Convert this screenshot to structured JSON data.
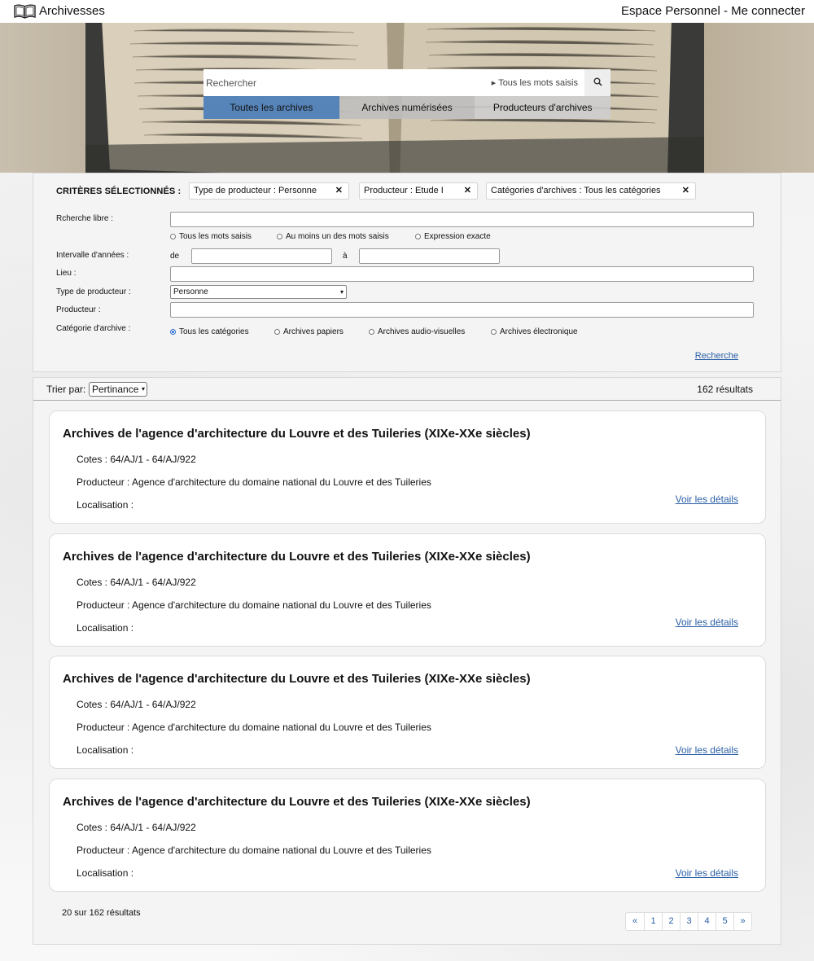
{
  "header": {
    "logo_text": "Archivesses",
    "account_link": "Espace Personnel - Me connecter"
  },
  "search": {
    "placeholder": "Rechercher",
    "mode": "Tous les mots saisis",
    "tabs": [
      "Toutes les archives",
      "Archives numérisées",
      "Producteurs d'archives"
    ]
  },
  "criteria": {
    "title": "CRITÈRES SÉLECTIONNÉS :",
    "chips": [
      "Type de producteur : Personne",
      "Producteur : Etude I",
      "Catégories d'archives : Tous les catégories"
    ],
    "chip_close": "✕",
    "free_search_label": "Rcherche libre :",
    "free_search_options": [
      "Tous les mots saisis",
      "Au moins un des mots saisis",
      "Expression exacte"
    ],
    "years_label": "Intervalle d'années :",
    "years_from": "de",
    "years_to": "à",
    "place_label": "Lieu :",
    "producer_type_label": "Type de producteur :",
    "producer_type_value": "Personne",
    "producer_label": "Producteur :",
    "category_label": "Catégorie d'archive :",
    "category_options": [
      "Tous les catégories",
      "Archives papiers",
      "Archives audio-visuelles",
      "Archives électronique"
    ],
    "search_link": "Recherche"
  },
  "results": {
    "sort_label": "Trier par:",
    "sort_value": "Pertinance",
    "count": "162 résultats",
    "items": [
      {
        "title": "Archives de l'agence d'architecture du Louvre et des Tuileries (XIXe-XXe siècles)",
        "cotes": "Cotes : 64/AJ/1 - 64/AJ/922",
        "producteur": "Producteur : Agence d'architecture du domaine national du Louvre et des Tuileries",
        "localisation": "Localisation :",
        "link": "Voir les détails"
      },
      {
        "title": "Archives de l'agence d'architecture du Louvre et des Tuileries (XIXe-XXe siècles)",
        "cotes": "Cotes : 64/AJ/1 - 64/AJ/922",
        "producteur": "Producteur : Agence d'architecture du domaine national du Louvre et des Tuileries",
        "localisation": "Localisation :",
        "link": "Voir les détails"
      },
      {
        "title": "Archives de l'agence d'architecture du Louvre et des Tuileries (XIXe-XXe siècles)",
        "cotes": "Cotes : 64/AJ/1 - 64/AJ/922",
        "producteur": "Producteur : Agence d'architecture du domaine national du Louvre et des Tuileries",
        "localisation": "Localisation :",
        "link": "Voir les détails"
      },
      {
        "title": "Archives de l'agence d'architecture du Louvre et des Tuileries (XIXe-XXe siècles)",
        "cotes": "Cotes : 64/AJ/1 - 64/AJ/922",
        "producteur": "Producteur : Agence d'architecture du domaine national du Louvre et des Tuileries",
        "localisation": "Localisation :",
        "link": "Voir les détails"
      }
    ],
    "pager_info": "20 sur 162 résultats",
    "pages": [
      "«",
      "1",
      "2",
      "3",
      "4",
      "5",
      "»"
    ]
  },
  "colors": {
    "active_tab": "#5784b8",
    "link": "#2a5fa6"
  }
}
